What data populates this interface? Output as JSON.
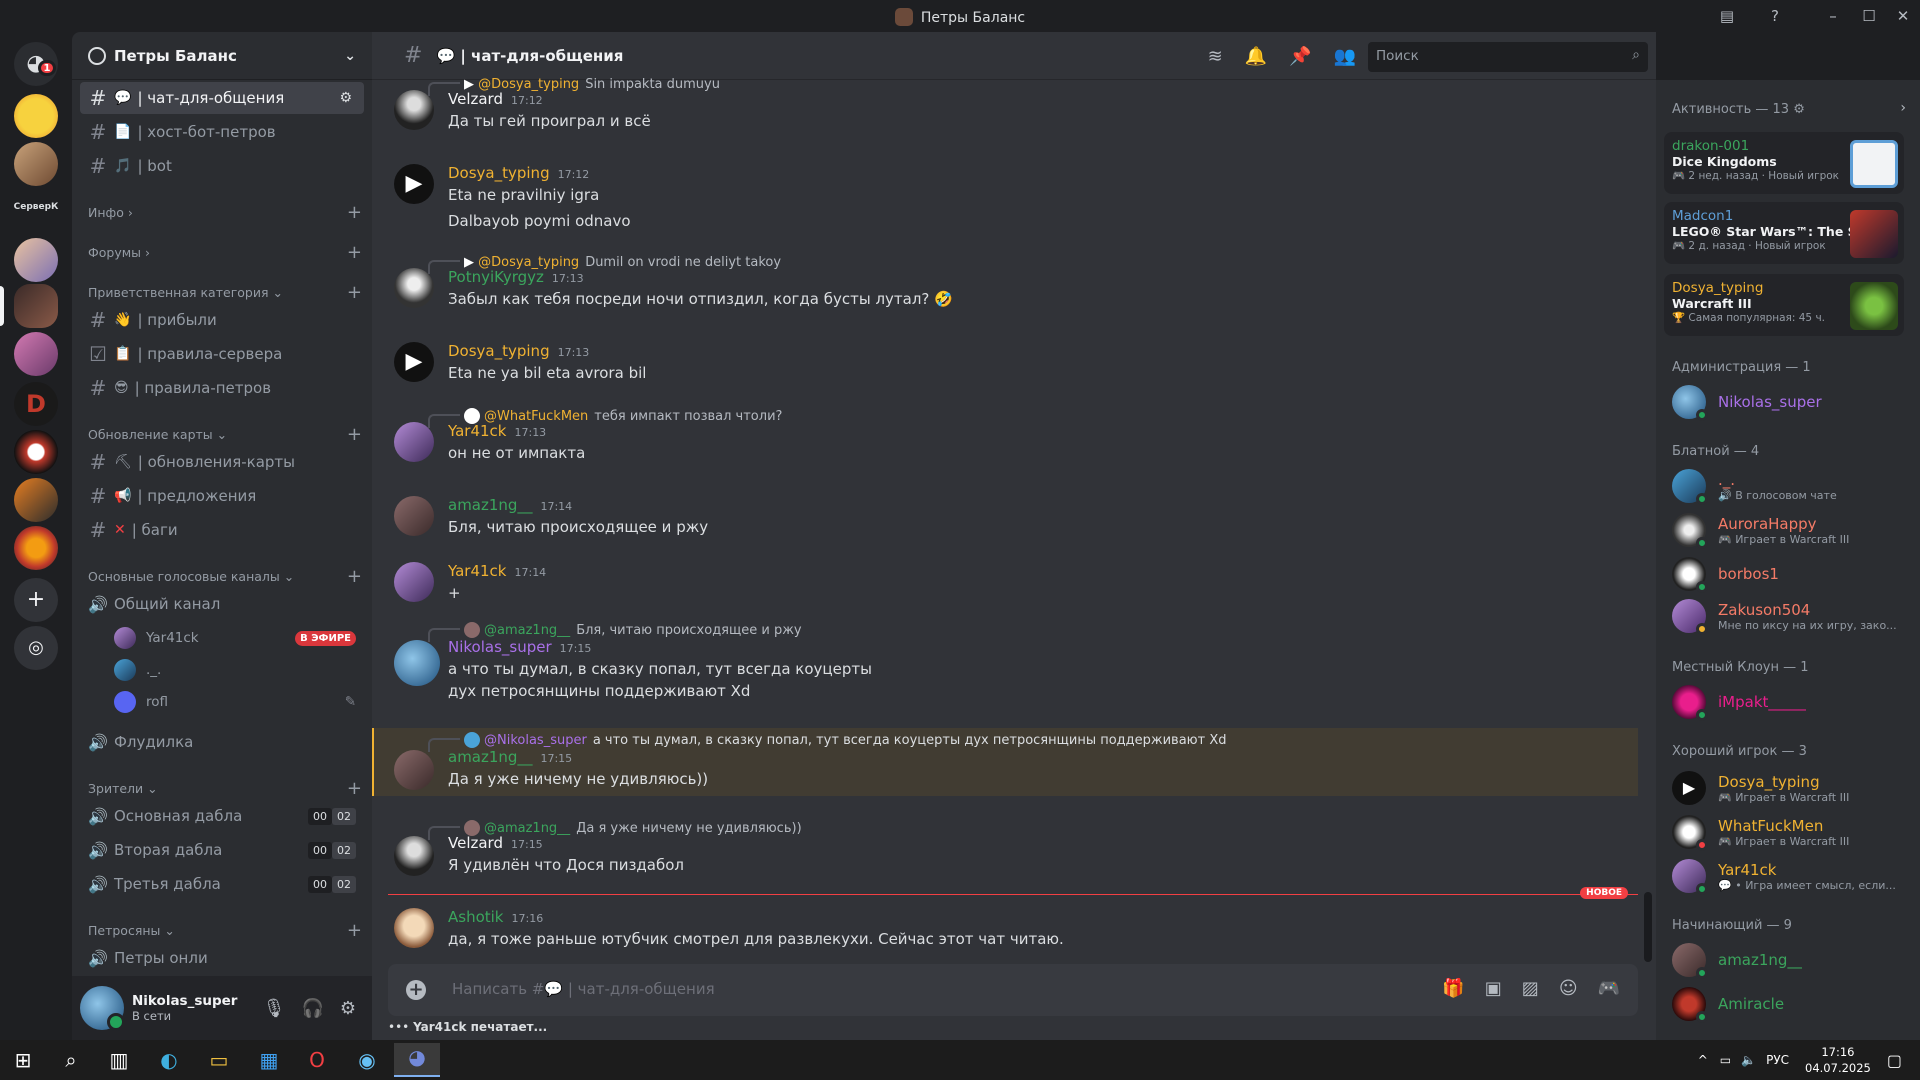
{
  "window": {
    "title": "Петры Баланс"
  },
  "rail": {
    "dm_badge": "1",
    "server_label": "СерверК"
  },
  "server": {
    "name": "Петры Баланс"
  },
  "channels": {
    "top": [
      {
        "name": "| чат-для-общения",
        "emoji": "💬",
        "active": true
      },
      {
        "name": "| хост-бот-петров",
        "emoji": "📄"
      },
      {
        "name": "| bot",
        "emoji": "🎵"
      }
    ],
    "cat_info": "Инфо",
    "cat_forums": "Форумы",
    "cat_welcome": "Приветственная категория",
    "welcome": [
      {
        "name": "| прибыли",
        "emoji": "👋"
      },
      {
        "name": "| правила-сервера",
        "emoji": "📋"
      },
      {
        "name": "| правила-петров",
        "emoji": "😎"
      }
    ],
    "cat_updates": "Обновление карты",
    "updates": [
      {
        "name": "| обновления-карты",
        "emoji": "⛏"
      },
      {
        "name": "| предложения",
        "emoji": "📢"
      },
      {
        "name": "| баги",
        "emoji": "❌"
      }
    ],
    "cat_voice": "Основные голосовые каналы",
    "voice_general": "Общий канал",
    "voice_users": [
      {
        "name": "Yar41ck",
        "live": "В ЭФИРЕ"
      },
      {
        "name": "._."
      },
      {
        "name": "rofl"
      }
    ],
    "voice_flood": "Флудилка",
    "cat_viewers": "Зрители",
    "viewers": [
      {
        "name": "Основная дабла",
        "c1": "00",
        "c2": "02"
      },
      {
        "name": "Вторая дабла",
        "c1": "00",
        "c2": "02"
      },
      {
        "name": "Третья дабла",
        "c1": "00",
        "c2": "02"
      }
    ],
    "cat_petro": "Петросяны",
    "petro_only": "Петры онли"
  },
  "user": {
    "name": "Nikolas_super",
    "status": "В сети"
  },
  "chat": {
    "channel": "| чат-для-общения",
    "search_placeholder": "Поиск",
    "composer_placeholder": "Написать #💬 | чат-для-общения",
    "typing": "Yar41ck печатает...",
    "new_label": "НОВОЕ",
    "messages": [
      {
        "reply_name": "@Dosya_typing",
        "reply_text": "Sin impakta dumuyu",
        "name": "Velzard",
        "time": "17:12",
        "lines": [
          "Да ты гей проиграл и всё"
        ]
      },
      {
        "name": "Dosya_typing",
        "time": "17:12",
        "lines": [
          "Eta ne pravilniy igra",
          "Dalbayob poymi odnavo"
        ]
      },
      {
        "reply_name": "@Dosya_typing",
        "reply_text": "Dumil on vrodi ne deliyt takoy",
        "name": "PotnyiKyrgyz",
        "time": "17:13",
        "lines": [
          "Забыл как тебя посреди ночи отпиздил, когда бусты лутал? 🤣"
        ]
      },
      {
        "name": "Dosya_typing",
        "time": "17:13",
        "lines": [
          "Eta ne ya bil eta avrora bil"
        ]
      },
      {
        "reply_name": "@WhatFuckMen",
        "reply_text": "тебя импакт позвал чтоли?",
        "name": "Yar41ck",
        "time": "17:13",
        "lines": [
          "он не от импакта"
        ]
      },
      {
        "name": "amaz1ng__",
        "time": "17:14",
        "lines": [
          "Бля, читаю происходящее и ржу"
        ]
      },
      {
        "name": "Yar41ck",
        "time": "17:14",
        "lines": [
          "+"
        ]
      },
      {
        "reply_name": "@amaz1ng__",
        "reply_text": "Бля, читаю происходящее и ржу",
        "name": "Nikolas_super",
        "time": "17:15",
        "lines": [
          "а что ты думал, в сказку попал, тут всегда коуцерты",
          "дух петросянщины поддерживают Xd"
        ]
      },
      {
        "reply_name": "@Nikolas_super",
        "reply_text": "а что ты думал, в сказку попал, тут всегда коуцерты  дух петросянщины поддерживают Xd",
        "name": "amaz1ng__",
        "time": "17:15",
        "lines": [
          "Да я уже ничему не удивляюсь))"
        ]
      },
      {
        "reply_name": "@amaz1ng__",
        "reply_text": "Да я уже ничему не удивляюсь))",
        "name": "Velzard",
        "time": "17:15",
        "lines": [
          "Я удивлён что Дося пиздабол"
        ]
      },
      {
        "name": "Ashotik",
        "time": "17:16",
        "lines": [
          "да, я тоже раньше ютубчик смотрел для развлекухи. Сейчас этот чат читаю."
        ]
      }
    ]
  },
  "members": {
    "activity_title": "Активность — 13",
    "activities": [
      {
        "user": "drakon-001",
        "game": "Dice Kingdoms",
        "sub": "2 нед. назад",
        "tag": "Новый игрок"
      },
      {
        "user": "Madcon1",
        "game": "LEGO® Star Wars™: The Sk...",
        "sub": "2 д. назад",
        "tag": "Новый игрок"
      },
      {
        "user": "Dosya_typing",
        "game": "Warcraft III",
        "sub": "Самая популярная: 45 ч."
      }
    ],
    "groups": [
      {
        "title": "Администрация — 1",
        "members": [
          {
            "name": "Nikolas_super"
          }
        ]
      },
      {
        "title": "Блатной — 4",
        "members": [
          {
            "name": "._.",
            "sub": "В голосовом чате"
          },
          {
            "name": "AuroraHappy",
            "sub": "Играет в Warcraft III"
          },
          {
            "name": "borbos1"
          },
          {
            "name": "Zakuson504",
            "sub": "Мне по иксу на их игру, зако..."
          }
        ]
      },
      {
        "title": "Местный Клоун — 1",
        "members": [
          {
            "name": "iMpakt_____"
          }
        ]
      },
      {
        "title": "Хороший игрок — 3",
        "members": [
          {
            "name": "Dosya_typing",
            "sub": "Играет в Warcraft III"
          },
          {
            "name": "WhatFuckMen",
            "sub": "Играет в Warcraft III"
          },
          {
            "name": "Yar41ck",
            "sub": "• Игра имеет смысл, если..."
          }
        ]
      },
      {
        "title": "Начинающий — 9",
        "members": [
          {
            "name": "amaz1ng__"
          },
          {
            "name": "Amiracle"
          }
        ]
      }
    ]
  },
  "taskbar": {
    "lang": "РУС",
    "time": "17:16",
    "date": "04.07.2025"
  },
  "colors": {
    "bg": "#313338",
    "sidebar": "#2b2d31",
    "rail": "#1e1f22",
    "yellow": "#f0b232",
    "green": "#3ba55d",
    "purple": "#a970e8",
    "orange": "#f47b67",
    "magenta": "#e91e8c",
    "blue": "#5e9ed6",
    "red": "#f23f43"
  }
}
